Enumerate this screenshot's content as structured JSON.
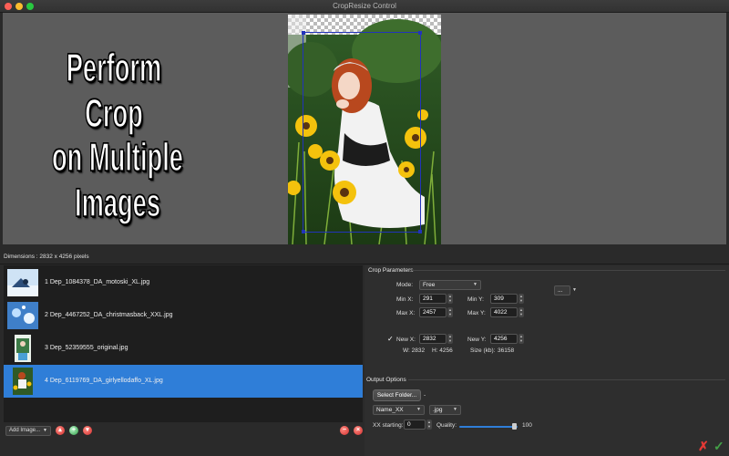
{
  "window": {
    "title": "CropResize Control"
  },
  "promo": {
    "line1": "Perform Crop",
    "line2": "on Multiple Images"
  },
  "dimensions": "Dimensions : 2832 x 4256 pixels",
  "files": [
    {
      "label": "1 Dep_1084378_DA_motoski_XL.jpg",
      "selected": false
    },
    {
      "label": "2 Dep_4467252_DA_christmasback_XXL.jpg",
      "selected": false
    },
    {
      "label": "3 Dep_52359555_original.jpg",
      "selected": false
    },
    {
      "label": "4 Dep_6119769_DA_girlyellodaffo_XL.jpg",
      "selected": true
    }
  ],
  "list_toolbar": {
    "add_image": "Add Image..."
  },
  "crop": {
    "section_title": "Crop Parameters",
    "mode_label": "Mode:",
    "mode_value": "Free",
    "extra_select": "...",
    "min_x_label": "Min X:",
    "min_x": "291",
    "min_y_label": "Min Y:",
    "min_y": "309",
    "max_x_label": "Max X:",
    "max_x": "2457",
    "max_y_label": "Max Y:",
    "max_y": "4022",
    "new_x_label": "New  X:",
    "new_x": "2832",
    "new_y_label": "New Y:",
    "new_y": "4256",
    "new_checked_mark": "✓",
    "w_text": "W: 2832",
    "h_text": "H: 4256",
    "size_label": "Size (kb):",
    "size_value": "36158"
  },
  "output": {
    "section_title": "Output Options",
    "select_folder": "Select Folder...",
    "folder_path": "-",
    "name_pattern": "Name_XX",
    "format": ".jpg",
    "xx_label": "XX starting:",
    "xx_value": "0",
    "quality_label": "Quality:",
    "quality_value": "100",
    "quality_fraction": 0.93
  },
  "colors": {
    "accent": "#2f7ed8",
    "cancel": "#e53935",
    "ok": "#43a047"
  }
}
